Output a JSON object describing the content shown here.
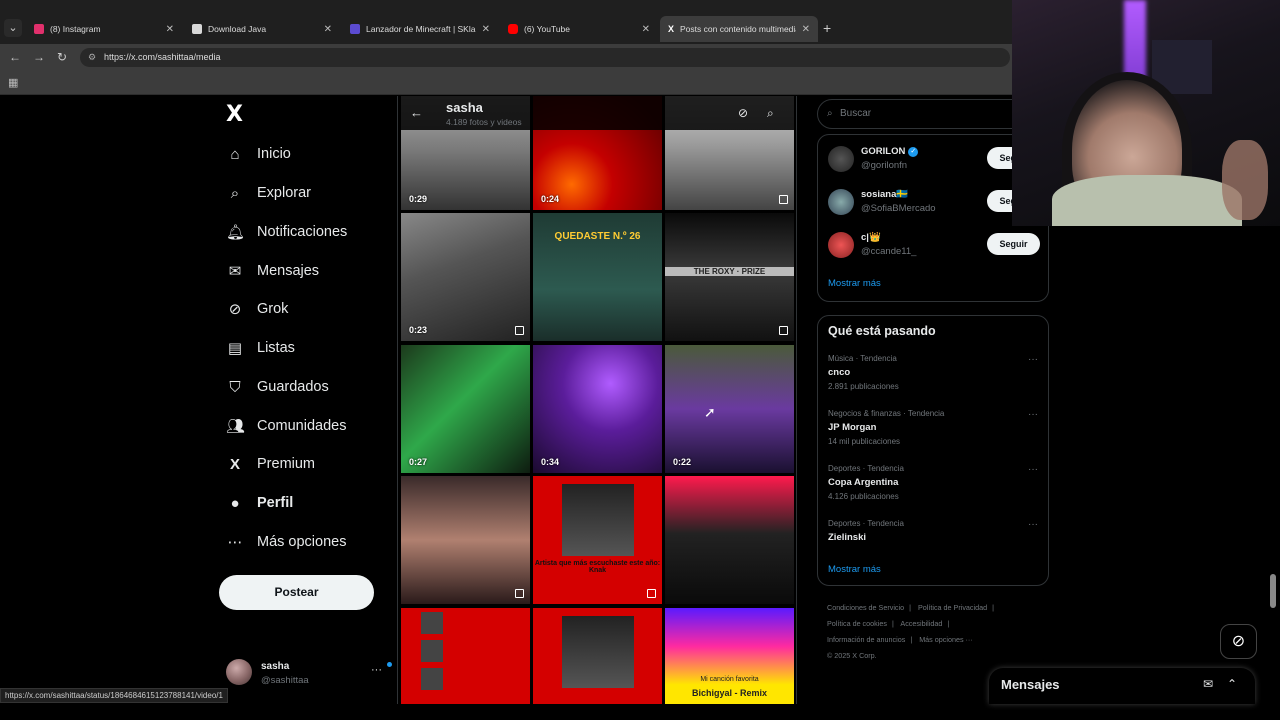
{
  "browser": {
    "tabs": [
      {
        "title": "(8) Instagram",
        "color": "#e1306c"
      },
      {
        "title": "Download Java",
        "color": "#999999"
      },
      {
        "title": "Lanzador de Minecraft | SKlaun…",
        "color": "#5b4bd1"
      },
      {
        "title": "(6) YouTube",
        "color": "#ff0000"
      },
      {
        "title": "Posts con contenido multimedia…",
        "color": "#ffffff"
      }
    ],
    "url": "https://x.com/sashittaa/media",
    "status_url": "https://x.com/sashittaa/status/1864684615123788141/video/1"
  },
  "nav": {
    "logo": "X",
    "items": [
      {
        "label": "Inicio",
        "icon": "home-icon",
        "glyph": "⌂"
      },
      {
        "label": "Explorar",
        "icon": "search-icon",
        "glyph": "⌕"
      },
      {
        "label": "Notificaciones",
        "icon": "bell-icon",
        "glyph": "🔔︎"
      },
      {
        "label": "Mensajes",
        "icon": "mail-icon",
        "glyph": "✉"
      },
      {
        "label": "Grok",
        "icon": "grok-icon",
        "glyph": "⊘"
      },
      {
        "label": "Listas",
        "icon": "list-icon",
        "glyph": "▤"
      },
      {
        "label": "Guardados",
        "icon": "bookmark-icon",
        "glyph": "⛉"
      },
      {
        "label": "Comunidades",
        "icon": "communities-icon",
        "glyph": "👥︎"
      },
      {
        "label": "Premium",
        "icon": "x-premium-icon",
        "glyph": "X"
      },
      {
        "label": "Perfil",
        "icon": "profile-icon",
        "glyph": "●"
      },
      {
        "label": "Más opciones",
        "icon": "more-options-icon",
        "glyph": "⋯"
      }
    ],
    "post_button": "Postear"
  },
  "profile": {
    "name": "sasha",
    "handle": "@sashittaa"
  },
  "media": {
    "title": "sasha",
    "subtitle": "4.189 fotos y videos",
    "items": [
      {
        "duration": "0:29",
        "multi": false
      },
      {
        "duration": "0:24",
        "multi": false
      },
      {
        "duration": "",
        "multi": true
      },
      {
        "duration": "0:23",
        "multi": true
      },
      {
        "duration": "",
        "multi": false,
        "overlay": "QUEDASTE N.º 26"
      },
      {
        "duration": "",
        "multi": true,
        "overlay": "THE ROXY · PRIZE"
      },
      {
        "duration": "0:27",
        "multi": false
      },
      {
        "duration": "0:34",
        "multi": false
      },
      {
        "duration": "0:22",
        "multi": false
      },
      {
        "duration": "",
        "multi": true
      },
      {
        "duration": "",
        "multi": true,
        "caption": "Artista que más escuchaste este año: Knak"
      },
      {
        "duration": "",
        "multi": false
      },
      {
        "duration": "",
        "multi": false
      },
      {
        "duration": "",
        "multi": false
      },
      {
        "duration": "",
        "multi": false,
        "caption": "Mi canción favorita",
        "overlay": "Bichigyal - Remix"
      }
    ]
  },
  "sidebar": {
    "search_placeholder": "Buscar",
    "who_to_follow": [
      {
        "name": "GORILON",
        "handle": "@gorilonfn",
        "verified": true,
        "button": "Seguir"
      },
      {
        "name": "sosiana🇸🇪",
        "handle": "@SofiaBMercado",
        "verified": false,
        "button": "Seguir"
      },
      {
        "name": "c|👑",
        "handle": "@ccande11_",
        "verified": false,
        "button": "Seguir"
      }
    ],
    "show_more": "Mostrar más",
    "trends_title": "Qué está pasando",
    "trends": [
      {
        "category": "Música · Tendencia",
        "name": "cnco",
        "count": "2.891 publicaciones"
      },
      {
        "category": "Negocios & finanzas · Tendencia",
        "name": "JP Morgan",
        "count": "14 mil publicaciones"
      },
      {
        "category": "Deportes · Tendencia",
        "name": "Copa Argentina",
        "count": "4.126 publicaciones"
      },
      {
        "category": "Deportes · Tendencia",
        "name": "Zielinski",
        "count": ""
      }
    ],
    "trends_more": "Mostrar más",
    "footer": [
      "Condiciones de Servicio",
      "|",
      "Política de Privacidad",
      "|",
      "Política de cookies",
      "|",
      "Accesibilidad",
      "|",
      "Información de anuncios",
      "|",
      "Más opciones ···",
      "© 2025 X Corp."
    ]
  },
  "messages_drawer": {
    "title": "Mensajes"
  }
}
